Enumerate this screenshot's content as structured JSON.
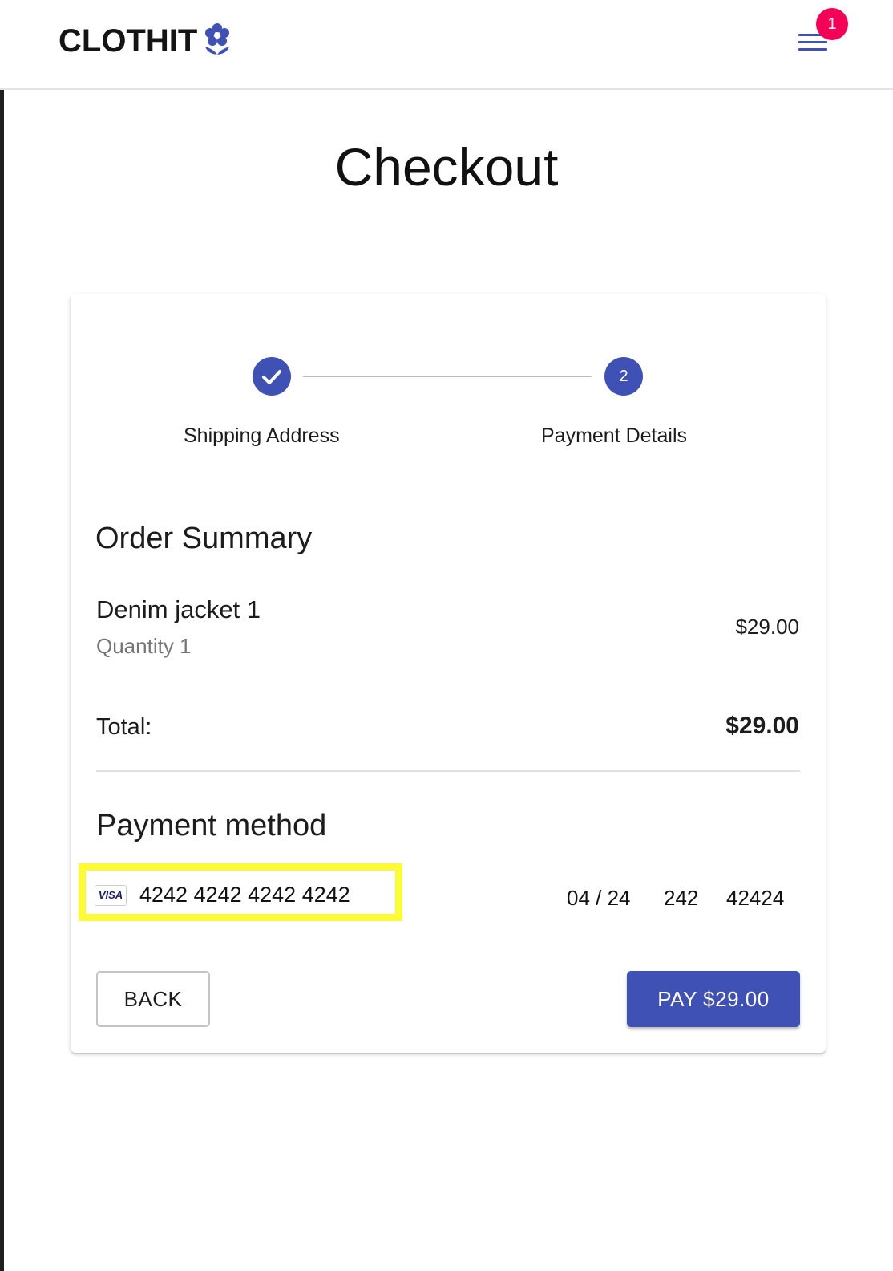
{
  "header": {
    "brand": "CLOTHIT",
    "brand_icon": "flower-icon",
    "menu_icon": "hamburger-menu-icon",
    "cart_badge": "1",
    "accent_color": "#3f51b5",
    "badge_color": "#f50057"
  },
  "page": {
    "title": "Checkout"
  },
  "stepper": {
    "steps": [
      {
        "label": "Shipping Address",
        "status": "completed",
        "icon": "check-icon"
      },
      {
        "label": "Payment Details",
        "number": "2",
        "status": "active"
      }
    ]
  },
  "order_summary": {
    "heading": "Order Summary",
    "items": [
      {
        "name": "Denim jacket 1",
        "quantity": "Quantity 1",
        "price": "$29.00"
      }
    ],
    "total_label": "Total:",
    "total_value": "$29.00"
  },
  "payment": {
    "heading": "Payment method",
    "card_brand": "VISA",
    "card_number": "4242 4242 4242 4242",
    "expiry": "04 / 24",
    "cvc": "242",
    "zip": "42424",
    "highlight_color": "#fdfb36"
  },
  "actions": {
    "back_label": "BACK",
    "pay_label": "PAY $29.00"
  }
}
